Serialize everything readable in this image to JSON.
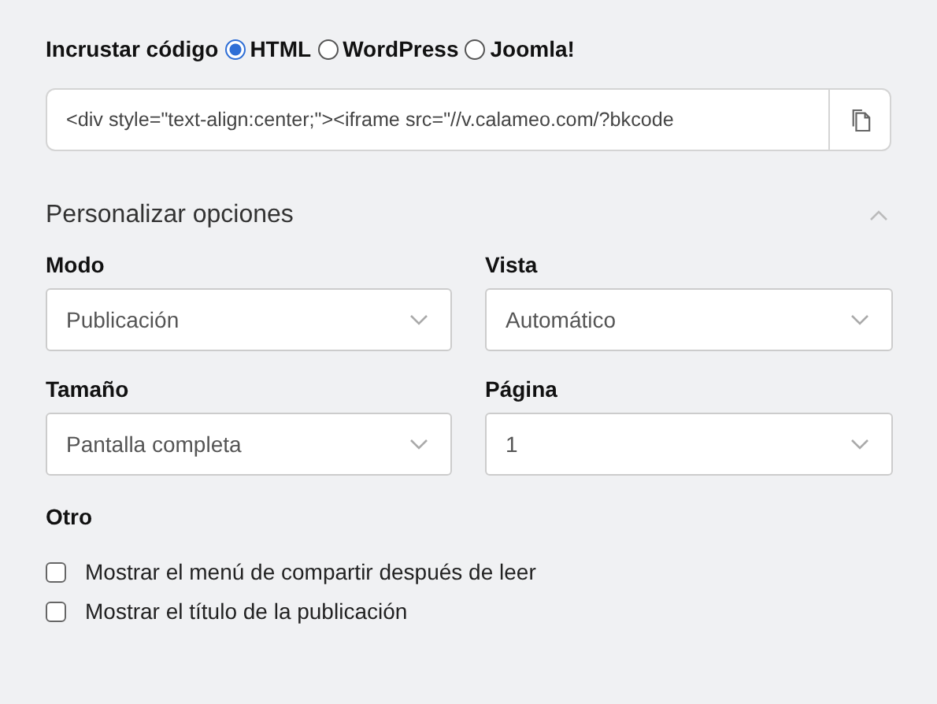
{
  "embed": {
    "label": "Incrustar código",
    "formats": [
      {
        "label": "HTML",
        "selected": true
      },
      {
        "label": "WordPress",
        "selected": false
      },
      {
        "label": "Joomla!",
        "selected": false
      }
    ],
    "code": "<div style=\"text-align:center;\"><iframe src=\"//v.calameo.com/?bkcode"
  },
  "customize": {
    "title": "Personalizar opciones",
    "expanded": true,
    "selects": [
      {
        "label": "Modo",
        "value": "Publicación"
      },
      {
        "label": "Vista",
        "value": "Automático"
      },
      {
        "label": "Tamaño",
        "value": "Pantalla completa"
      },
      {
        "label": "Página",
        "value": "1"
      }
    ],
    "other": {
      "label": "Otro",
      "options": [
        {
          "label": "Mostrar el menú de compartir después de leer",
          "checked": false
        },
        {
          "label": "Mostrar el título de la publicación",
          "checked": false
        }
      ]
    }
  }
}
